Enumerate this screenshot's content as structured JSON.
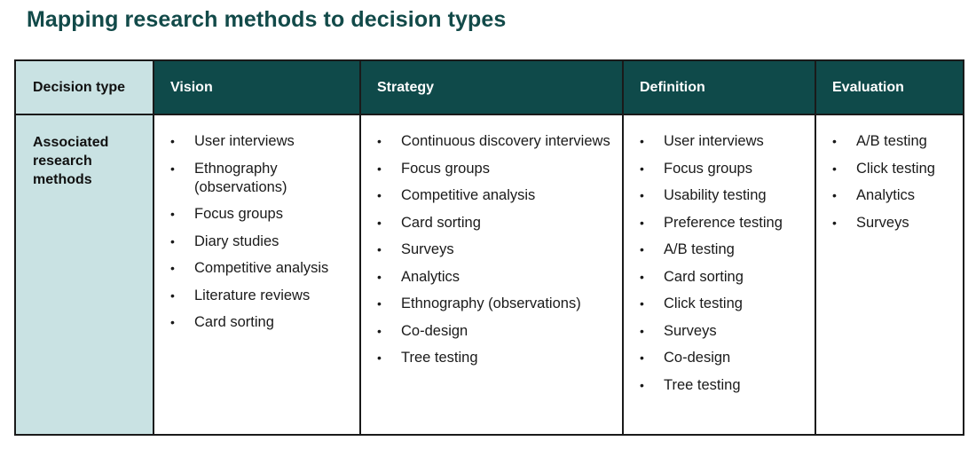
{
  "title": "Mapping research methods to decision types",
  "colors": {
    "title": "#124a49",
    "header_bg": "#0f4a4a",
    "row_header_bg": "#c9e2e3"
  },
  "table": {
    "row_header_label": "Decision type",
    "row_label": "Associated research methods",
    "columns": [
      {
        "header": "Vision",
        "methods": [
          "User interviews",
          "Ethnography (observations)",
          "Focus groups",
          "Diary studies",
          "Competitive analysis",
          "Literature reviews",
          "Card sorting"
        ]
      },
      {
        "header": "Strategy",
        "methods": [
          "Continuous discovery interviews",
          "Focus groups",
          "Competitive analysis",
          "Card sorting",
          "Surveys",
          "Analytics",
          "Ethnography (observations)",
          "Co-design",
          "Tree testing"
        ]
      },
      {
        "header": "Definition",
        "methods": [
          "User interviews",
          "Focus groups",
          "Usability testing",
          "Preference testing",
          "A/B testing",
          "Card sorting",
          "Click testing",
          "Surveys",
          "Co-design",
          "Tree testing"
        ]
      },
      {
        "header": "Evaluation",
        "methods": [
          "A/B testing",
          "Click testing",
          "Analytics",
          "Surveys"
        ]
      }
    ],
    "bullet_glyph": "•"
  }
}
